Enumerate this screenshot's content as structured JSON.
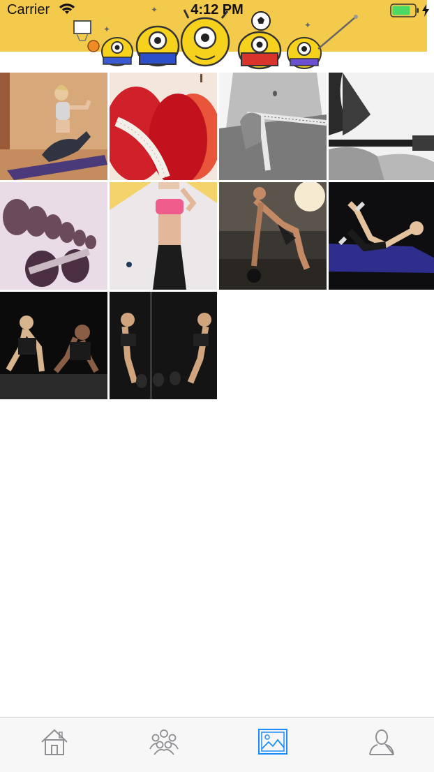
{
  "status_bar": {
    "carrier": "Carrier",
    "time": "4:12 PM",
    "battery_level": 0.8
  },
  "header": {
    "banner_icon": "mascot-banner"
  },
  "gallery": {
    "items": [
      {
        "icon": "yoga-woman-photo"
      },
      {
        "icon": "apples-measuring-tape-photo"
      },
      {
        "icon": "waist-measuring-tape-photo"
      },
      {
        "icon": "barbell-lift-photo"
      },
      {
        "icon": "dumbbell-rack-photo"
      },
      {
        "icon": "fit-woman-sport-bra-photo"
      },
      {
        "icon": "dumbbell-row-photo"
      },
      {
        "icon": "crunches-mat-photo"
      },
      {
        "icon": "couple-pushups-photo"
      },
      {
        "icon": "mirror-dumbbell-photo"
      }
    ]
  },
  "tabbar": {
    "tabs": [
      {
        "icon": "home-icon",
        "selected": false
      },
      {
        "icon": "community-icon",
        "selected": false
      },
      {
        "icon": "gallery-icon",
        "selected": true
      },
      {
        "icon": "profile-icon",
        "selected": false
      }
    ],
    "colors": {
      "active": "#1a8cff",
      "inactive": "#8e8e93"
    }
  }
}
